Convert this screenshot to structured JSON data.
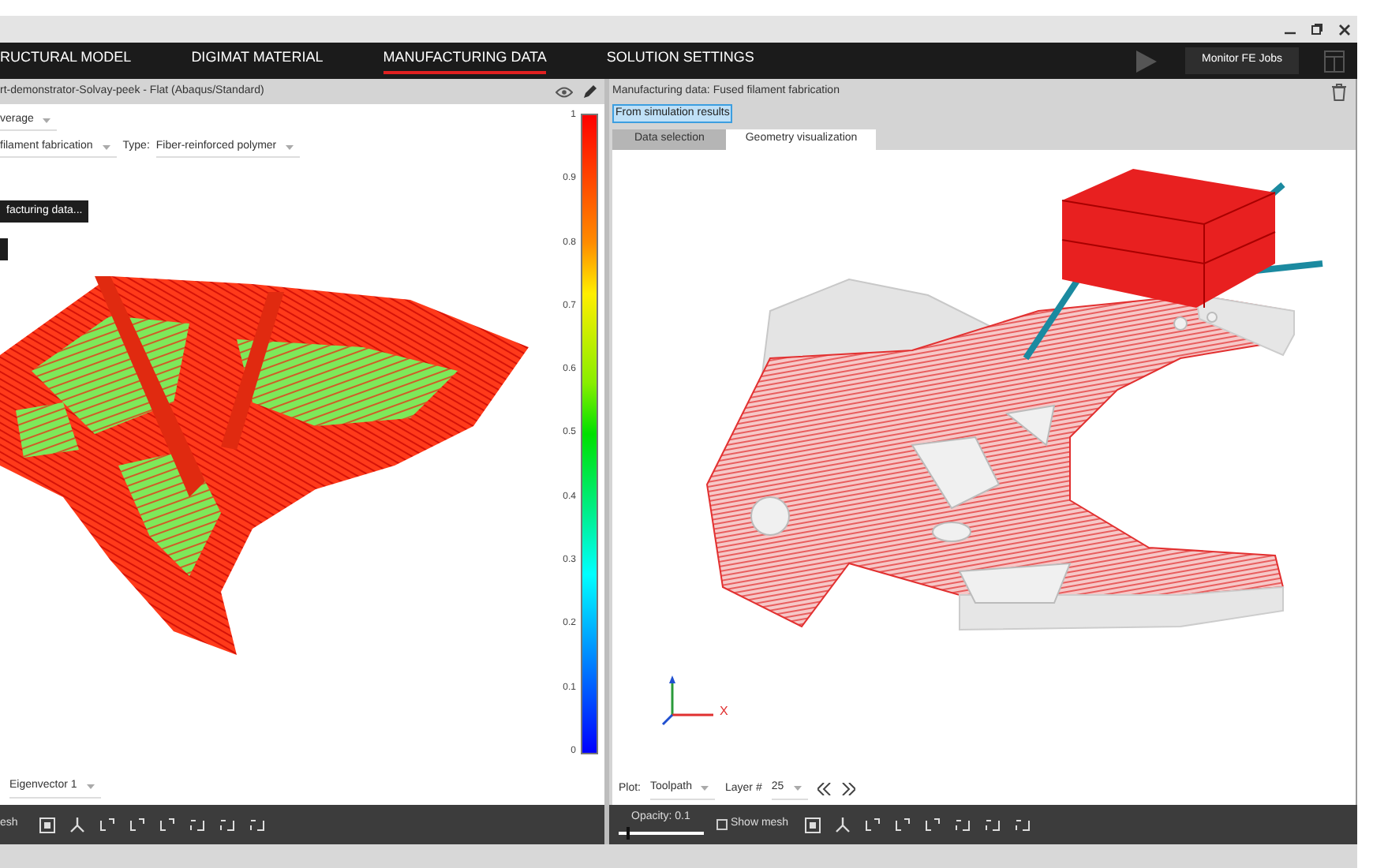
{
  "nav": {
    "tabs": [
      {
        "label": "RUCTURAL MODEL",
        "selected": false
      },
      {
        "label": "DIGIMAT MATERIAL",
        "selected": false
      },
      {
        "label": "MANUFACTURING DATA",
        "selected": true
      },
      {
        "label": "SOLUTION SETTINGS",
        "selected": false
      }
    ],
    "monitor_button": "Monitor FE Jobs"
  },
  "left_panel": {
    "title": "rt-demonstrator-Solvay-peek - Flat (Abaqus/Standard)",
    "average_dropdown": "verage",
    "process_dropdown": "filament fabrication",
    "type_label": "Type:",
    "type_dropdown": "Fiber-reinforced polymer",
    "action_button": "facturing data...",
    "legend_ticks": [
      "1",
      "0.9",
      "0.8",
      "0.7",
      "0.6",
      "0.5",
      "0.4",
      "0.3",
      "0.2",
      "0.1",
      "0"
    ],
    "vector_dropdown": "Eigenvector 1",
    "toolbar_label": "esh"
  },
  "right_panel": {
    "title": "Manufacturing data: Fused filament fabrication",
    "source_button": "From simulation results",
    "tabs": [
      {
        "label": "Data selection",
        "selected": false
      },
      {
        "label": "Geometry visualization",
        "selected": true
      }
    ],
    "axis_label": "X",
    "plot_label": "Plot:",
    "plot_dropdown": "Toolpath",
    "layer_label": "Layer #",
    "layer_dropdown": "25",
    "opacity": {
      "label": "Opacity: 0.1",
      "level": 0.1
    },
    "show_mesh": {
      "label": "Show mesh",
      "checked": false
    }
  }
}
